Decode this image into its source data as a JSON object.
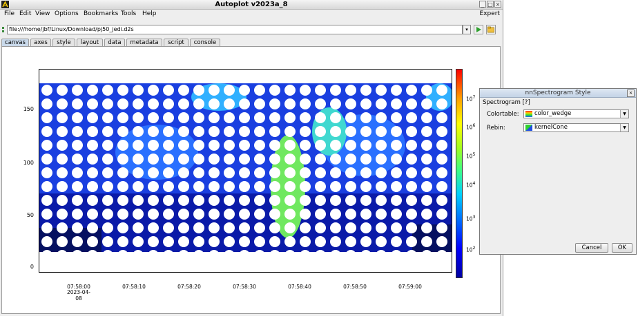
{
  "window": {
    "title": "Autoplot v2023a_8",
    "controls": [
      "_",
      "□",
      "×"
    ]
  },
  "menu": {
    "items": [
      "File",
      "Edit",
      "View",
      "Options",
      "Bookmarks",
      "Tools",
      "Help"
    ],
    "expert": "Expert"
  },
  "address": {
    "value": "file:///home/jbf/Linux/Download/pj50_jedi.d2s",
    "dropdown_glyph": "▾",
    "go_icon": "play-icon",
    "folder_icon": "folder-icon"
  },
  "tabs": [
    "canvas",
    "axes",
    "style",
    "layout",
    "data",
    "metadata",
    "script",
    "console"
  ],
  "active_tab": "canvas",
  "plot": {
    "y_ticks": [
      "150",
      "100",
      "50",
      "0"
    ],
    "x_ticks": [
      "07:58:00",
      "07:58:10",
      "07:58:20",
      "07:58:30",
      "07:58:40",
      "07:58:50",
      "07:59:00"
    ],
    "x_date": "2023-04-08",
    "colorbar_ticks": [
      "10",
      "10",
      "10",
      "10",
      "10",
      "10"
    ],
    "colorbar_exponents": [
      "7",
      "6",
      "5",
      "4",
      "3",
      "2"
    ],
    "colors": {
      "low": "#0000a0",
      "mid": "#40ff80",
      "high": "#ff0000"
    }
  },
  "dialog": {
    "title": "nnSpectrogram Style",
    "close": "×",
    "group": "Spectrogram [?]",
    "colortable_label": "Colortable:",
    "colortable_value": "color_wedge",
    "rebin_label": "Rebin:",
    "rebin_value": "kernelCone",
    "cancel": "Cancel",
    "ok": "OK"
  }
}
